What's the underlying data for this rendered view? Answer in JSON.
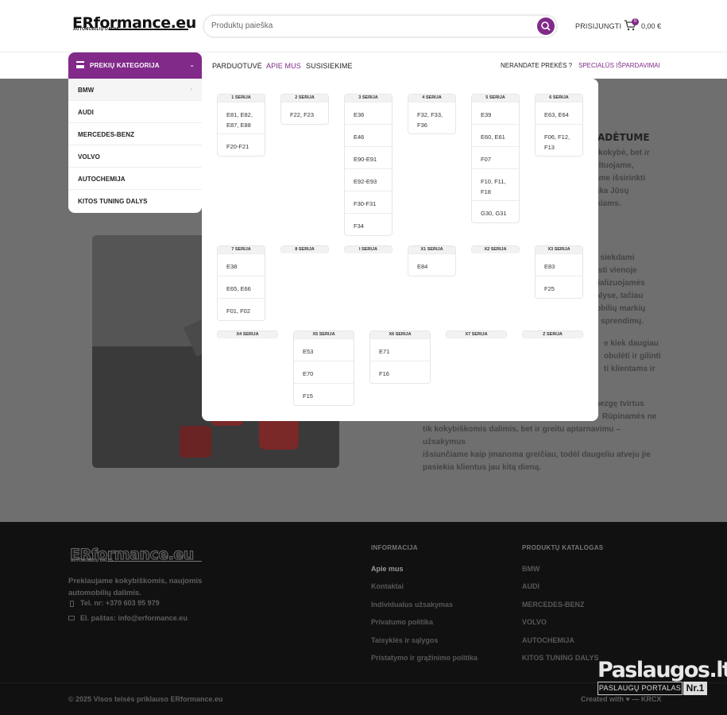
{
  "header": {
    "logo_text": "ERformance.eu",
    "logo_sub": "AUTOMOBILIŲ DALYS",
    "search_placeholder": "Produktų paieška",
    "login_label": "PRISIJUNGTI",
    "cart_count": "0",
    "cart_total": "0,00 €"
  },
  "nav": {
    "category_button": "PREKIŲ KATEGORIJA",
    "items": [
      "PARDUOTUVĖ",
      "APIE MUS",
      "SUSISIEKIME"
    ],
    "right_items": [
      "NERANDATE PREKĖS ?",
      "SPECIALŪS IŠPARDAVIMAI"
    ]
  },
  "categories": [
    "BMW",
    "AUDI",
    "MERCEDES-BENZ",
    "VOLVO",
    "AUTOCHEMIJA",
    "KITOS TUNING DALYS"
  ],
  "mega_menu": {
    "row1": [
      {
        "title": "1 SERIJA",
        "items": [
          "E81, E82, E87, E88",
          "F20-F21"
        ]
      },
      {
        "title": "2 SERIJA",
        "items": [
          "F22, F23"
        ]
      },
      {
        "title": "3 SERIJA",
        "items": [
          "E36",
          "E46",
          "E90-E91",
          "E92-E93",
          "F30-F31",
          "F34"
        ]
      },
      {
        "title": "4 SERIJA",
        "items": [
          "F32, F33, F36"
        ]
      },
      {
        "title": "5 SERIJA",
        "items": [
          "E39",
          "E60, E61",
          "F07",
          "F10, F11, F18",
          "G30, G31"
        ]
      },
      {
        "title": "6 SERIJA",
        "items": [
          "E63, E64",
          "F06, F12, F13"
        ]
      }
    ],
    "row2": [
      {
        "title": "7 SERIJA",
        "items": [
          "E38",
          "E65, E66",
          "F01, F02"
        ]
      },
      {
        "title": "8 SERIJA",
        "items": []
      },
      {
        "title": "I SERIJA",
        "items": []
      },
      {
        "title": "X1 SERIJA",
        "items": [
          "E84"
        ]
      },
      {
        "title": "X2 SERIJA",
        "items": []
      },
      {
        "title": "X3 SERIJA",
        "items": [
          "E83",
          "F25"
        ]
      }
    ],
    "row3": [
      {
        "title": "X4 SERIJA",
        "items": []
      },
      {
        "title": "X5 SERIJA",
        "items": [
          "E53",
          "E70",
          "F15"
        ]
      },
      {
        "title": "X6 SERIJA",
        "items": [
          "E71",
          "F16"
        ]
      },
      {
        "title": "X7 SERIJA",
        "items": []
      },
      {
        "title": "Z SERIJA",
        "items": []
      }
    ]
  },
  "background_text": {
    "heading_tail": "ADĖTUME",
    "p1": [
      "ik kokybė, bet ir",
      "sultuojame,",
      "dame išsirinkti",
      "tinka Jūsų",
      "eikiams."
    ],
    "p2": [
      "ntą, siekdami",
      "i, rasti vienoje",
      "pecializuojamės",
      "ų dalyse, tačiau",
      "omobilių markių",
      "ngo sprendimų."
    ],
    "p3": [
      "e kiek daugiau",
      "obulėti ir gilinti",
      "ti klientams ir"
    ],
    "p4": [
      "nezgę tvirtus",
      "Rūpinamės ne",
      "tik kokybiškomis dalimis, bet ir greitu aptarnavimu – užsakymus",
      "išsiunčiame kaip įmanoma greičiau, todėl daugeliu atveju jie",
      "pasiekia klientus jau kitą dieną."
    ]
  },
  "footer": {
    "logo_text": "ERformance.eu",
    "logo_sub": "AUTOMOBILIŲ DALYS",
    "description": "Prekiaujame kokybiškomis, naujomis automobilių dalimis.",
    "phone": "Tel. nr: +370 603 95 979",
    "email": "El. paštas: info@erformance.eu",
    "info_title": "INFORMACIJA",
    "info_links": [
      "Apie mus",
      "Kontaktai",
      "Individualus užsakymas",
      "Privatumo politika",
      "Taisyklės ir sąlygos",
      "Pristatymo ir grąžinimo politika"
    ],
    "catalog_title": "PRODUKTŲ KATALOGAS",
    "catalog_links": [
      "BMW",
      "AUDI",
      "MERCEDES-BENZ",
      "VOLVO",
      "AUTOCHEMIJA",
      "KITOS TUNING DALYS"
    ],
    "copyright": "© 2025 Visos teisės priklauso ERformance.eu",
    "created": "Created with ♥ — KRCX",
    "badge_title": "Paslaugos.lt",
    "badge_sub": "PASLAUGŲ PORTALAS",
    "badge_nr": "Nr.1"
  }
}
